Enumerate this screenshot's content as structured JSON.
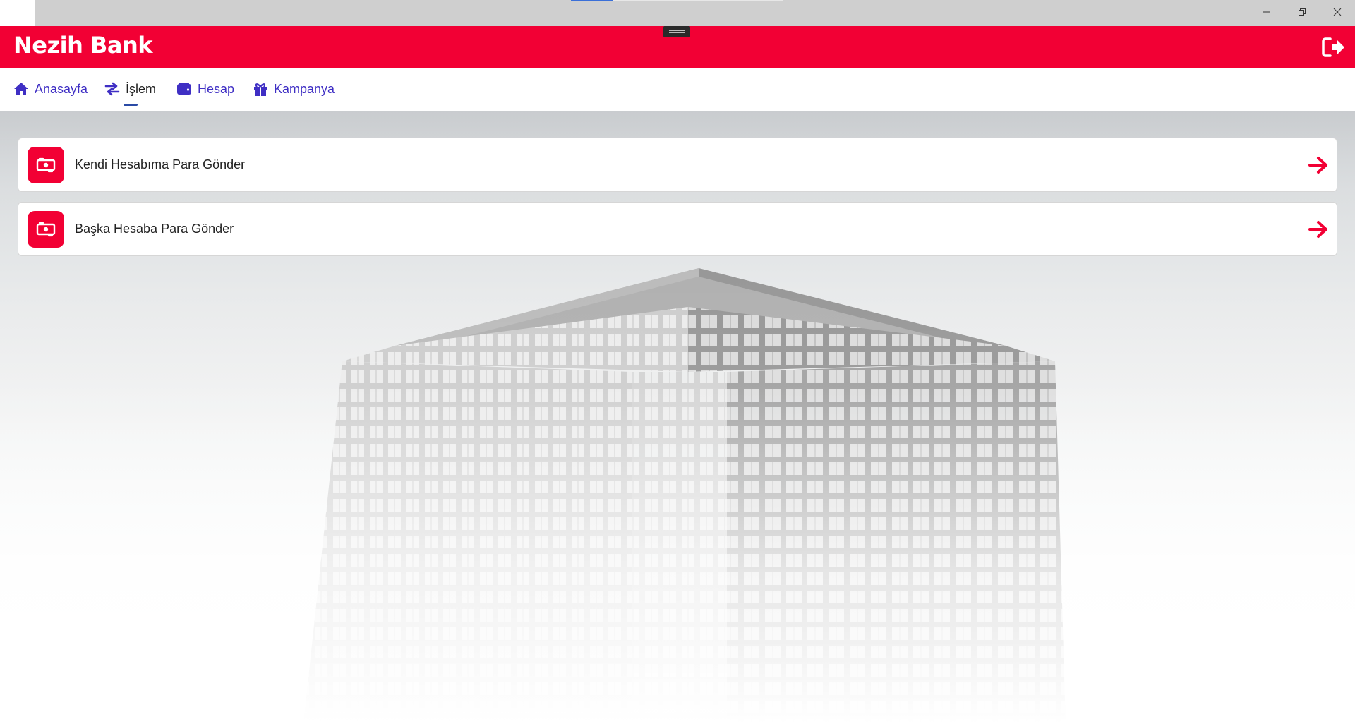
{
  "app": {
    "brand": "Nezih Bank",
    "accent_color": "#f20034",
    "nav_color": "#3f2fc4"
  },
  "window": {
    "minimize_icon": "minimize-icon",
    "maximize_icon": "restore-icon",
    "close_icon": "close-icon"
  },
  "header": {
    "logout_icon": "logout-icon"
  },
  "nav": {
    "items": [
      {
        "label": "Anasayfa",
        "icon": "home-icon"
      },
      {
        "label": "İşlem",
        "icon": "transfer-icon",
        "active": true
      },
      {
        "label": "Hesap",
        "icon": "wallet-icon"
      },
      {
        "label": "Kampanya",
        "icon": "gift-icon"
      }
    ]
  },
  "actions": [
    {
      "label": "Kendi Hesabıma Para Gönder",
      "icon": "money-transfer-icon",
      "arrow_icon": "arrow-right-icon"
    },
    {
      "label": "Başka Hesaba Para Gönder",
      "icon": "money-transfer-icon",
      "arrow_icon": "arrow-right-icon"
    }
  ]
}
